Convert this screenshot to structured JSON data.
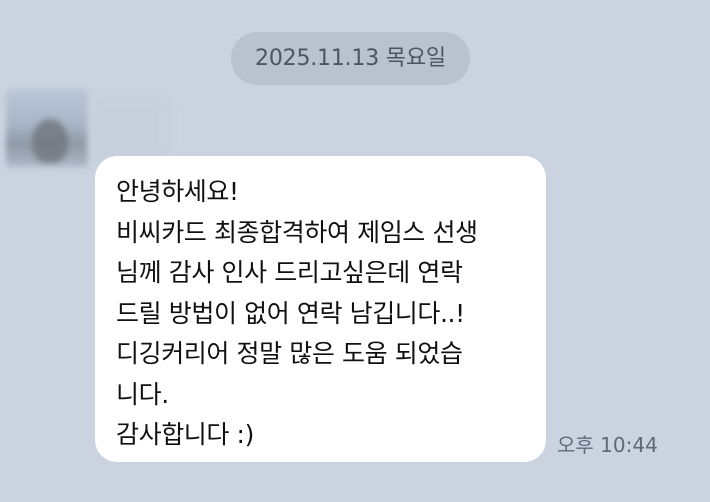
{
  "date_divider": {
    "text": "2025.11.13 목요일"
  },
  "sender": {
    "avatar_icon": "profile-avatar-blurred",
    "name_icon": "sender-name-blurred"
  },
  "message": {
    "lines": [
      "안녕하세요!",
      "비씨카드 최종합격하여 제임스 선생",
      "님께 감사 인사 드리고싶은데 연락",
      "드릴 방법이 없어 연락 남깁니다..!",
      "디깅커리어 정말 많은 도움 되었습",
      "니다.",
      "감사합니다 :)"
    ],
    "timestamp": "오후 10:44"
  },
  "colors": {
    "background": "#cbd3e0",
    "date_pill": "#bac2cf",
    "bubble": "#ffffff",
    "text": "#111111",
    "timestamp": "#5f6977"
  }
}
